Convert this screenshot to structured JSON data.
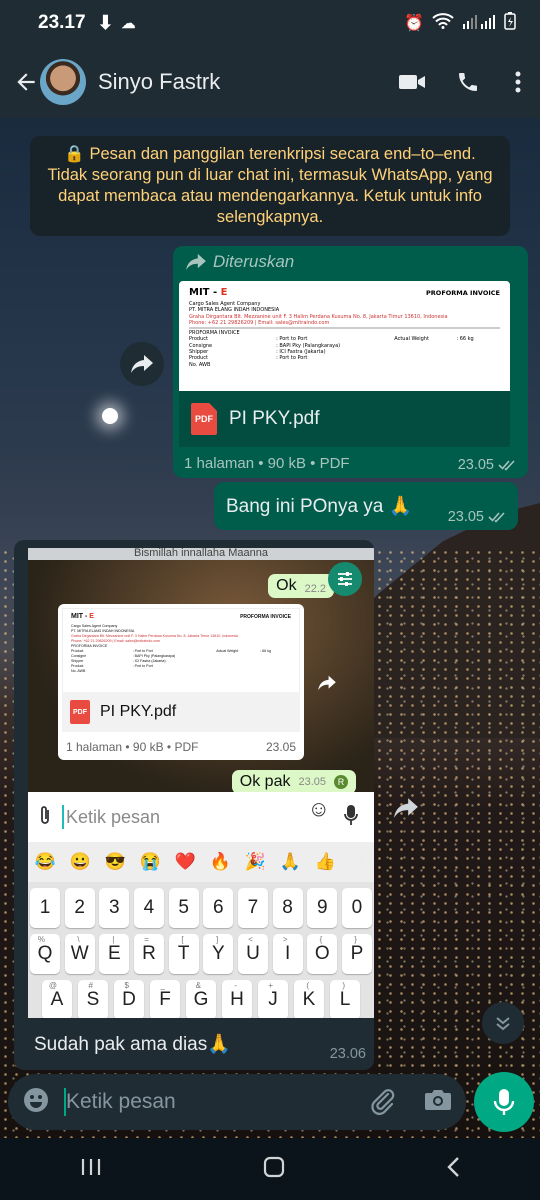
{
  "status_bar": {
    "time": "23.17"
  },
  "header": {
    "contact_name": "Sinyo Fastrk"
  },
  "encryption_note": "🔒 Pesan dan panggilan terenkripsi secara end–to–end. Tidak seorang pun di luar chat ini, termasuk WhatsApp, yang dapat membaca atau mendengarkannya. Ketuk untuk info selengkapnya.",
  "messages": {
    "forwarded_doc": {
      "forward_label": "Diteruskan",
      "file_name": "PI PKY.pdf",
      "meta": "1 halaman • 90 kB • PDF",
      "time": "23.05",
      "preview": {
        "logo_prefix": "MIT - ",
        "logo_accent": "E",
        "doc_title": "PROFORMA INVOICE",
        "company": "Cargo Sales Agent Company",
        "company2": "PT. MITRA ELANG INDAH INDONESIA",
        "address": "Graha Dirgantara Blt. Mezzanine unit F. 3  Halim Perdana Kusuma No. 8, Jakarta Timur 13610, Indonesia",
        "phone": "Phone: +62 21 29826209  |  Email: sales@mitraindo.com",
        "section": "PROFORMA INVOICE",
        "rows": [
          {
            "label": "Product",
            "value": ": Port to Port",
            "extra": "Actual Weight",
            "extra_val": ": 66 kg"
          },
          {
            "label": "Consigne",
            "value": ": BAPI Pky (Palangkaraya)",
            "extra": "",
            "extra_val": ""
          },
          {
            "label": "Shipper",
            "value": ": ICI Fastra (Jakarta)",
            "extra": "",
            "extra_val": ""
          },
          {
            "label": "Product",
            "value": ": Port to Port",
            "extra": "",
            "extra_val": ""
          },
          {
            "label": "No. AWB",
            "value": "",
            "extra": "",
            "extra_val": ""
          }
        ]
      }
    },
    "text_msg": {
      "text": "Bang ini POnya ya 🙏",
      "time": "23.05"
    },
    "image_msg": {
      "caption": "Sudah pak ama dias🙏",
      "time": "23.06",
      "screenshot": {
        "top_strip": "Bismillah innallaha Maanna",
        "ok_text": "Ok",
        "ok_time": "22.2",
        "file_name": "PI PKY.pdf",
        "file_meta": "1 halaman • 90 kB • PDF",
        "file_time": "23.05",
        "okpak_text": "Ok pak",
        "okpak_time": "23.05",
        "okpak_badge": "R",
        "input_placeholder": "Ketik pesan",
        "emoji_row": [
          "😂",
          "😀",
          "😎",
          "😭",
          "❤️",
          "🔥",
          "🎉",
          "🙏",
          "👍",
          "☺"
        ],
        "keys_row1": [
          "1",
          "2",
          "3",
          "4",
          "5",
          "6",
          "7",
          "8",
          "9",
          "0"
        ],
        "keys_row2": [
          "Q",
          "W",
          "E",
          "R",
          "T",
          "Y",
          "U",
          "I",
          "O",
          "P"
        ],
        "keys_row2_sup": [
          "%",
          "\\",
          "|",
          "=",
          "[",
          "]",
          "<",
          ">",
          "{",
          "}"
        ],
        "keys_row3": [
          "A",
          "S",
          "D",
          "F",
          "G",
          "H",
          "J",
          "K",
          "L"
        ],
        "keys_row3_sup": [
          "@",
          "#",
          "$",
          "_",
          "&",
          "-",
          "+",
          "(",
          ")"
        ]
      }
    }
  },
  "composer": {
    "placeholder": "Ketik pesan"
  },
  "colors": {
    "header_bg": "#1f2c34",
    "outgoing_bubble": "#005c4b",
    "incoming_bubble": "#202c33",
    "accent": "#00a884",
    "encryption_text": "#ffd279"
  },
  "icons": [
    "back-arrow-icon",
    "video-call-icon",
    "voice-call-icon",
    "more-options-icon",
    "forward-icon",
    "pdf-icon",
    "double-check-icon",
    "emoji-icon",
    "attach-icon",
    "camera-icon",
    "mic-icon",
    "scroll-down-icon",
    "nav-recents-icon",
    "nav-home-icon",
    "nav-back-icon"
  ]
}
